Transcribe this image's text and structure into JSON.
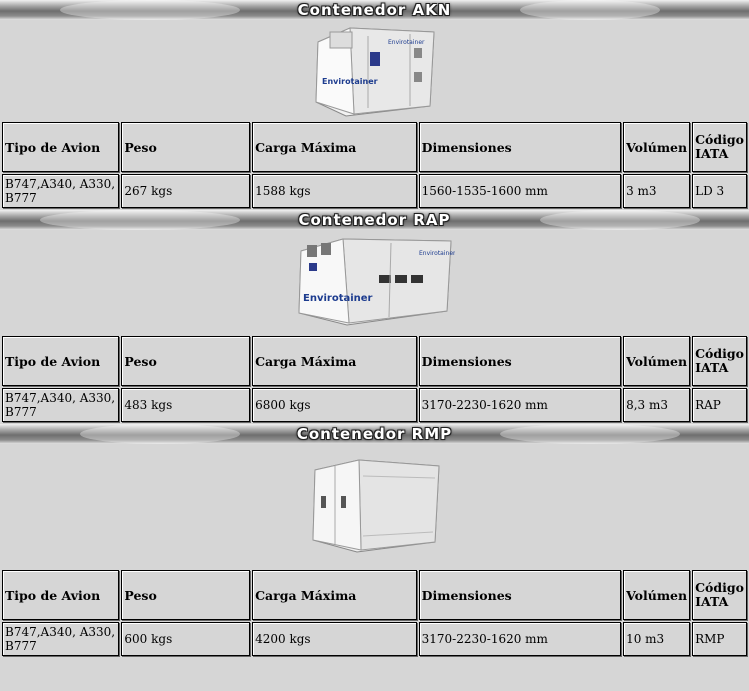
{
  "columns": [
    "Tipo de Avion",
    "Peso",
    "Carga Máxima",
    "Dimensiones",
    "Volúmen",
    "Código IATA"
  ],
  "sections": [
    {
      "title": "Contenedor AKN",
      "image": "envirotainer-akn-container",
      "image_label": "Envirotainer",
      "row": [
        "B747,A340, A330, B777",
        "267 kgs",
        "1588 kgs",
        "1560-1535-1600 mm",
        "3 m3",
        "LD 3"
      ]
    },
    {
      "title": "Contenedor RAP",
      "image": "envirotainer-rap-container",
      "image_label": "Envirotainer",
      "row": [
        "B747,A340, A330, B777",
        "483 kgs",
        "6800 kgs",
        "3170-2230-1620 mm",
        "8,3 m3",
        "RAP"
      ]
    },
    {
      "title": "Contenedor RMP",
      "image": "envirotainer-rmp-container",
      "image_label": "",
      "row": [
        "B747,A340, A330, B777",
        "600 kgs",
        "4200 kgs",
        "3170-2230-1620 mm",
        "10 m3",
        "RMP"
      ]
    }
  ]
}
